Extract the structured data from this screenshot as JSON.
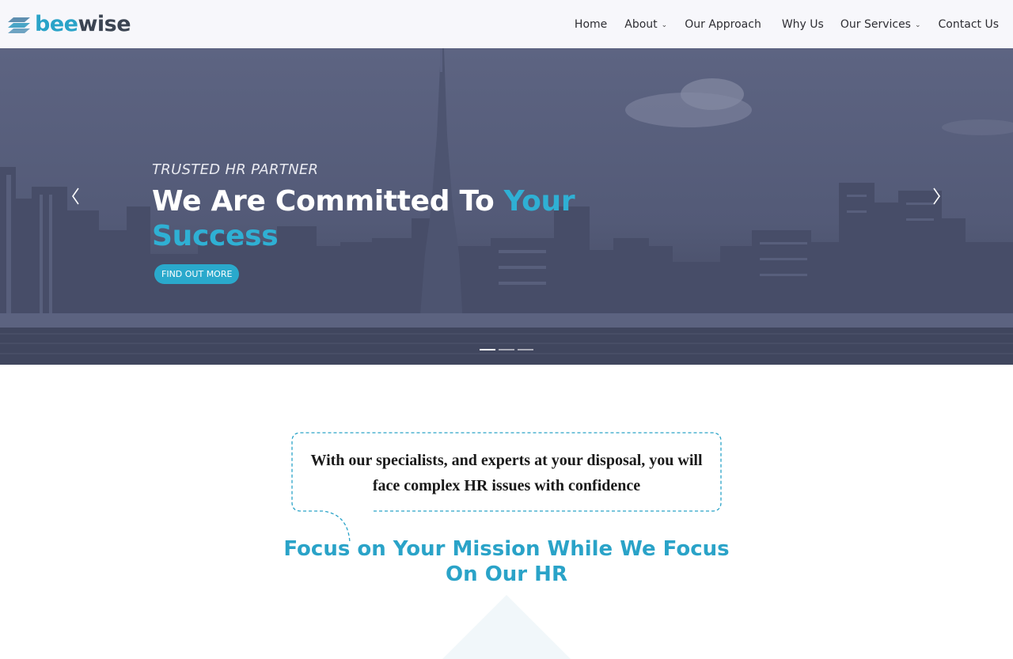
{
  "brand": {
    "logo_part1": "bee",
    "logo_part2": "wise",
    "logo_icon": "stripes-logo-icon",
    "accent_color": "#2aa3c8",
    "dark_color": "#3b4452"
  },
  "nav": {
    "items": [
      {
        "label": "Home",
        "has_dropdown": false
      },
      {
        "label": "About",
        "has_dropdown": true
      },
      {
        "label": "Our Approach",
        "has_dropdown": false
      },
      {
        "label": "Why Us",
        "has_dropdown": false
      },
      {
        "label": "Our Services",
        "has_dropdown": true
      },
      {
        "label": "Contact Us",
        "has_dropdown": false
      }
    ],
    "dropdown_icon": "chevron-down-icon",
    "dropdown_glyph": "⌄"
  },
  "hero": {
    "eyebrow": "TRUSTED HR PARTNER",
    "title_white": "We Are Committed To",
    "title_accent": "Your Success",
    "button_label": "FIND OUT MORE",
    "prev_icon": "chevron-left-icon",
    "next_icon": "chevron-right-icon",
    "slides_count": 3,
    "active_slide": 1
  },
  "intro": {
    "quote": "With our specialists, and experts at your disposal, you will face complex HR issues with confidence",
    "heading": "Focus on Your Mission While We Focus On Our HR"
  }
}
